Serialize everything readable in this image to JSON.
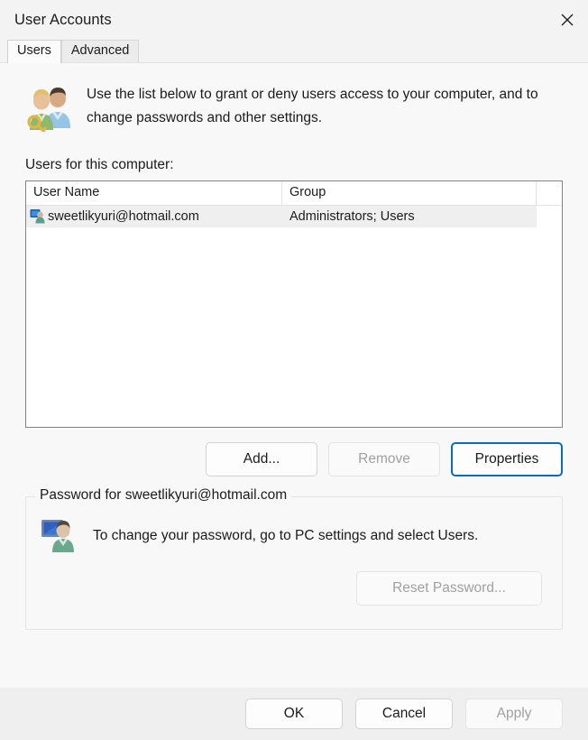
{
  "window": {
    "title": "User Accounts",
    "close_icon": "close-icon"
  },
  "tabs": [
    {
      "label": "Users",
      "active": true
    },
    {
      "label": "Advanced",
      "active": false
    }
  ],
  "main": {
    "intro_icon": "users-key-icon",
    "intro_text": "Use the list below to grant or deny users access to your computer, and to change passwords and other settings.",
    "list_label": "Users for this computer:",
    "list": {
      "columns": [
        "User Name",
        "Group",
        ""
      ],
      "rows": [
        {
          "icon": "user-account-icon",
          "user_name": "sweetlikyuri@hotmail.com",
          "group": "Administrators; Users",
          "selected": true
        }
      ]
    },
    "list_buttons": [
      {
        "label": "Add...",
        "state": "normal"
      },
      {
        "label": "Remove",
        "state": "disabled"
      },
      {
        "label": "Properties",
        "state": "focused"
      }
    ],
    "password_group": {
      "legend": "Password for sweetlikyuri@hotmail.com",
      "icon": "user-monitor-icon",
      "text": "To change your password, go to PC settings and select Users.",
      "button": {
        "label": "Reset Password...",
        "state": "disabled"
      }
    }
  },
  "footer": {
    "buttons": [
      {
        "label": "OK",
        "state": "normal"
      },
      {
        "label": "Cancel",
        "state": "normal"
      },
      {
        "label": "Apply",
        "state": "disabled"
      }
    ]
  },
  "colors": {
    "accent": "#0d6bbd",
    "dialog_bg": "#f8f8f8",
    "titlebar_bg": "#f3f3f3",
    "footer_bg": "#efefef",
    "selection_bg": "#efefef",
    "text": "#1b1b1b",
    "disabled_text": "#a0a0a0"
  }
}
